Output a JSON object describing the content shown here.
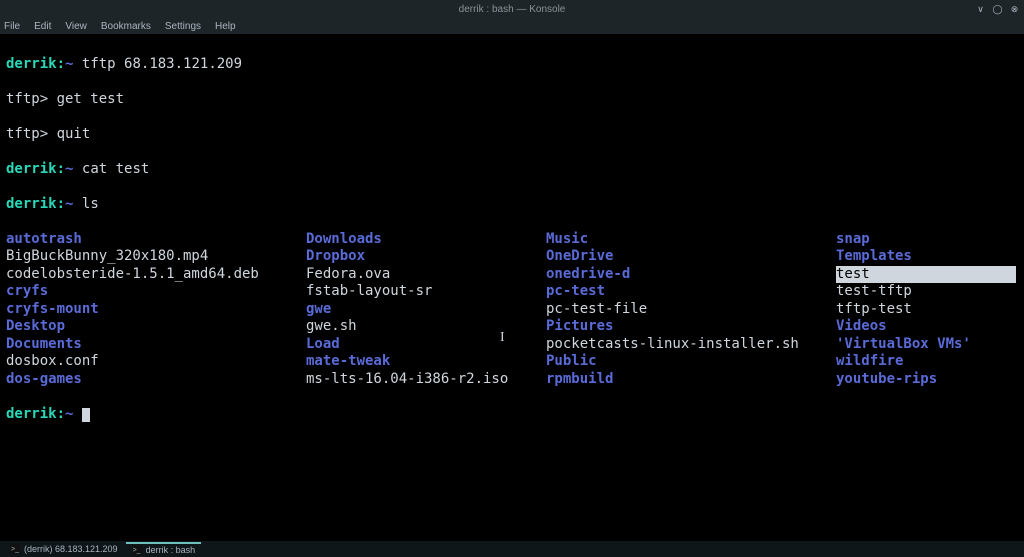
{
  "title": "derrik : bash — Konsole",
  "menu": {
    "file": "File",
    "edit": "Edit",
    "view": "View",
    "bookmarks": "Bookmarks",
    "settings": "Settings",
    "help": "Help"
  },
  "prompt": {
    "user": "derrik",
    "sep": ":",
    "path": "~",
    "arrow": " "
  },
  "lines": {
    "l1_cmd": "tftp 68.183.121.209",
    "l2": "tftp> get test",
    "l3": "tftp> quit",
    "l4_cmd": "cat test",
    "l5_cmd": "ls"
  },
  "ls": {
    "col1": [
      {
        "t": "autotrash",
        "c": "dir"
      },
      {
        "t": "BigBuckBunny_320x180.mp4",
        "c": "file"
      },
      {
        "t": "codelobsteride-1.5.1_amd64.deb",
        "c": "file"
      },
      {
        "t": "cryfs",
        "c": "dir"
      },
      {
        "t": "cryfs-mount",
        "c": "dir"
      },
      {
        "t": "Desktop",
        "c": "dir"
      },
      {
        "t": "Documents",
        "c": "dir"
      },
      {
        "t": "dosbox.conf",
        "c": "file"
      },
      {
        "t": "dos-games",
        "c": "dir"
      }
    ],
    "col2": [
      {
        "t": "Downloads",
        "c": "dir"
      },
      {
        "t": "Dropbox",
        "c": "dir"
      },
      {
        "t": "Fedora.ova",
        "c": "file"
      },
      {
        "t": "fstab-layout-sr",
        "c": "file"
      },
      {
        "t": "gwe",
        "c": "dir"
      },
      {
        "t": "gwe.sh",
        "c": "file"
      },
      {
        "t": "Load",
        "c": "dir"
      },
      {
        "t": "mate-tweak",
        "c": "dir"
      },
      {
        "t": "ms-lts-16.04-i386-r2.iso",
        "c": "file"
      }
    ],
    "col3": [
      {
        "t": "Music",
        "c": "dir"
      },
      {
        "t": "OneDrive",
        "c": "dir"
      },
      {
        "t": "onedrive-d",
        "c": "dir"
      },
      {
        "t": "pc-test",
        "c": "dir"
      },
      {
        "t": "pc-test-file",
        "c": "file"
      },
      {
        "t": "Pictures",
        "c": "dir"
      },
      {
        "t": "pocketcasts-linux-installer.sh",
        "c": "file"
      },
      {
        "t": "Public",
        "c": "dir"
      },
      {
        "t": "rpmbuild",
        "c": "dir"
      }
    ],
    "col4": [
      {
        "t": "snap",
        "c": "dir"
      },
      {
        "t": "Templates",
        "c": "dir"
      },
      {
        "t": "test",
        "c": "sel"
      },
      {
        "t": "test-tftp",
        "c": "file"
      },
      {
        "t": "tftp-test",
        "c": "file"
      },
      {
        "t": "Videos",
        "c": "dir"
      },
      {
        "t": "'VirtualBox VMs'",
        "c": "quoted"
      },
      {
        "t": "wildfire",
        "c": "dir"
      },
      {
        "t": "youtube-rips",
        "c": "dir"
      }
    ]
  },
  "taskbar": {
    "item1": "(derrik) 68.183.121.209",
    "item2": "derrik : bash"
  },
  "window_controls": {
    "min": "∨",
    "max": "◯",
    "close": "⊗"
  }
}
